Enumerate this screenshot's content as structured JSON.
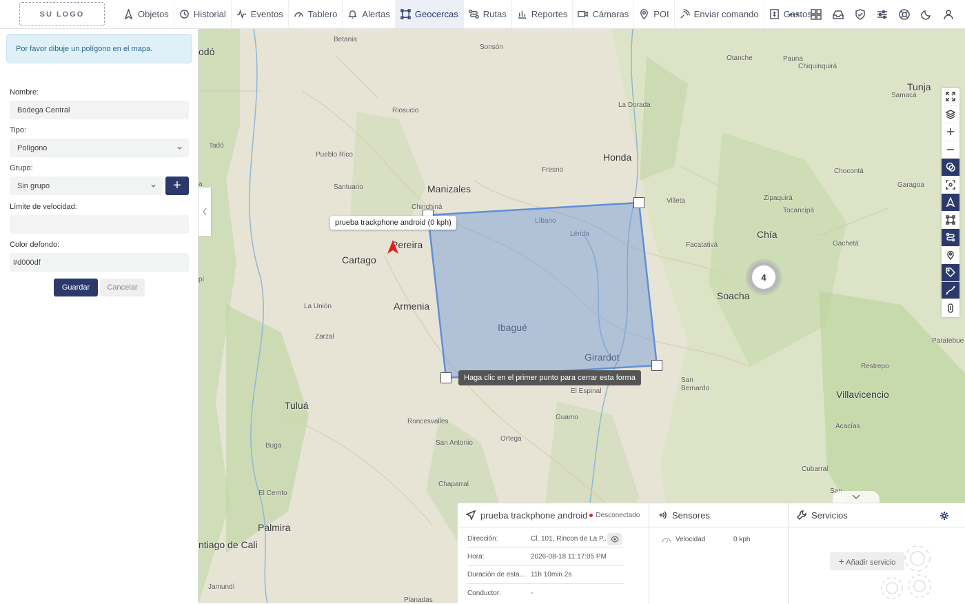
{
  "logo": "SU LOGO",
  "nav": [
    {
      "label": "Objetos",
      "icon": "navigation-icon"
    },
    {
      "label": "Historial",
      "icon": "history-icon"
    },
    {
      "label": "Eventos",
      "icon": "pulse-icon"
    },
    {
      "label": "Tablero",
      "icon": "gauge-icon"
    },
    {
      "label": "Alertas",
      "icon": "bell-icon"
    },
    {
      "label": "Geocercas",
      "icon": "geofence-icon",
      "active": true
    },
    {
      "label": "Rutas",
      "icon": "route-icon"
    },
    {
      "label": "Reportes",
      "icon": "bar-chart-icon"
    },
    {
      "label": "Cámaras",
      "icon": "video-icon"
    },
    {
      "label": "POI",
      "icon": "map-pin-icon"
    },
    {
      "label": "Enviar comando",
      "icon": "broadcast-icon"
    },
    {
      "label": "Gastos",
      "icon": "expense-icon"
    }
  ],
  "form": {
    "info": "Por favor dibuje un polígono en el mapa.",
    "name_label": "Nombre:",
    "name_value": "Bodega Central",
    "type_label": "Tipo:",
    "type_value": "Polígono",
    "group_label": "Grupo:",
    "group_value": "Sin grupo",
    "add_group": "+",
    "speed_label": "Límite de velocidad:",
    "speed_value": "",
    "color_label": "Color defondo:",
    "color_value": "#d000df",
    "save": "Guardar",
    "cancel": "Cancelar"
  },
  "map": {
    "vehicle_tooltip": "prueba trackphone android (0 kph)",
    "draw_hint": "Haga clic en el primer punto para cerrar esta forma",
    "cluster_count": "4",
    "polygon_color": "#5f8fd8",
    "vehicle_color": "#e02020",
    "cities": [
      "Manizales",
      "Honda",
      "Pereira",
      "Cartago",
      "Armenia",
      "Ibagué",
      "Girardot",
      "Chía",
      "Soacha",
      "Tunja",
      "Villavicencio",
      "Tuluá",
      "Palmira",
      "ntiago de Cali",
      "odó"
    ],
    "towns": [
      "Betania",
      "Sonsón",
      "Otanche",
      "Pauna",
      "Chiquinquirá",
      "Samacá",
      "Riosucio",
      "La Dorada",
      "Tadó",
      "Pueblo Rico",
      "Fresno",
      "Chocontá",
      "Santuario",
      "Chinchiná",
      "Villeta",
      "Zipaquirá",
      "Garagoa",
      "Tocancipá",
      "Líbano",
      "Lérida",
      "Facatativá",
      "Gachetá",
      "La Unión",
      "Zarzal",
      "Paratebue",
      "Restrepo",
      "San Bernardo",
      "El Espinal",
      "Guamo",
      "Roncesvalles",
      "San Antonio",
      "Ortega",
      "Acacías",
      "Buga",
      "Chaparral",
      "Cubarral",
      "El Cerrito",
      "Jamundí",
      "Planadas",
      "San",
      "pí",
      "a"
    ]
  },
  "vehicle_panel": {
    "name": "prueba trackphone android",
    "status": "Desconectado",
    "rows": [
      {
        "key": "Dirección:",
        "value": "Cl. 101, Rincon de La P..."
      },
      {
        "key": "Hora:",
        "value": "2026-08-18 11:17:05 PM"
      },
      {
        "key": "Duración de esta...",
        "value": "11h 10min 2s"
      },
      {
        "key": "Conductor:",
        "value": "-"
      }
    ]
  },
  "sensors": {
    "title": "Sensores",
    "items": [
      {
        "name": "Velocidad",
        "value": "0 kph"
      }
    ]
  },
  "services": {
    "title": "Servicios",
    "add": "Añadir servicio"
  }
}
